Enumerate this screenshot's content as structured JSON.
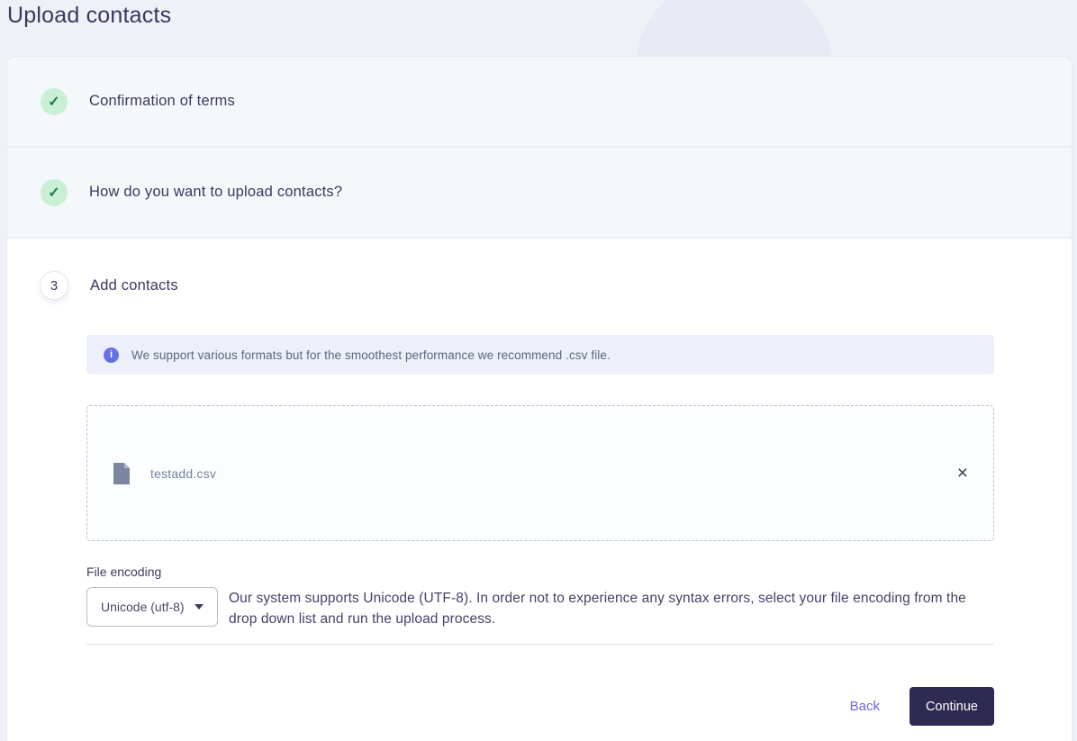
{
  "colors": {
    "accent_indigo": "#6570e4",
    "success_bg": "#c9f0d4",
    "success_check": "#27774a",
    "dark_navy": "#3b3760",
    "continue_bg": "#2e2a52",
    "link_purple": "#6e68ea"
  },
  "page": {
    "title": "Upload contacts"
  },
  "steps": [
    {
      "label": "Confirmation of terms",
      "status": "complete"
    },
    {
      "label": "How do you want to upload contacts?",
      "status": "complete"
    },
    {
      "number": "3",
      "label": "Add contacts",
      "status": "active"
    }
  ],
  "info_banner": {
    "text": "We support various formats but for the smoothest performance we recommend .csv file."
  },
  "dropzone": {
    "file_name": "testadd.csv"
  },
  "encoding": {
    "label": "File encoding",
    "selected_option": "Unicode (utf-8)",
    "help_text": "Our system supports Unicode (UTF-8). In order not to experience any syntax errors, select your file encoding from the drop down list and run the upload process."
  },
  "footer": {
    "back_label": "Back",
    "continue_label": "Continue"
  },
  "icons": {
    "check": "✓",
    "info": "i",
    "close": "×"
  }
}
